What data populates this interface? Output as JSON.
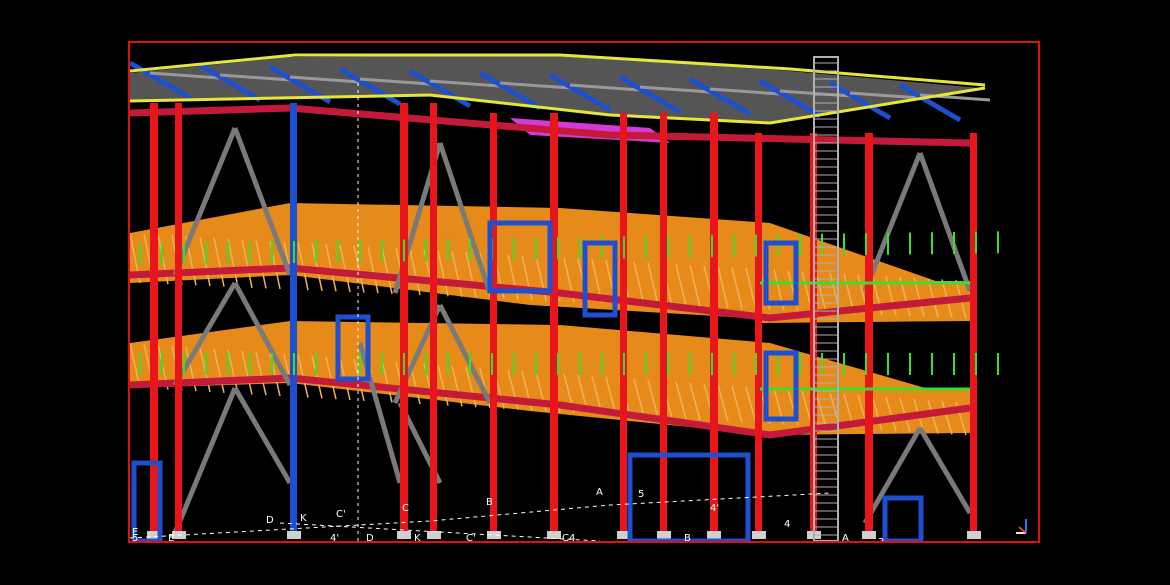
{
  "viewport": {
    "name": "3D structural steel model view",
    "frame_color": "#e01010",
    "background": "#000000"
  },
  "colors": {
    "column": "#e8151b",
    "beam": "#c41a3a",
    "brace": "#7a7a7a",
    "purlin": "#1f4fd1",
    "rail": "#3adf2a",
    "grating": "#e68a1a",
    "grating_light": "#f0b25a",
    "roof_rail": "#e6e63a",
    "plate": "#d63ad6",
    "ladder": "#b0b0b0"
  },
  "grid_labels": [
    {
      "text": "E"
    },
    {
      "text": "5"
    },
    {
      "text": "E"
    },
    {
      "text": "D"
    },
    {
      "text": "K"
    },
    {
      "text": "C'"
    },
    {
      "text": "4'"
    },
    {
      "text": "D"
    },
    {
      "text": "C"
    },
    {
      "text": "K"
    },
    {
      "text": "C'"
    },
    {
      "text": "B"
    },
    {
      "text": "C4"
    },
    {
      "text": "A"
    },
    {
      "text": "5"
    },
    {
      "text": "4'"
    },
    {
      "text": "B"
    },
    {
      "text": "4"
    },
    {
      "text": "A"
    },
    {
      "text": "3"
    }
  ],
  "axis_triad": {
    "icon": "axis-triad-icon"
  }
}
